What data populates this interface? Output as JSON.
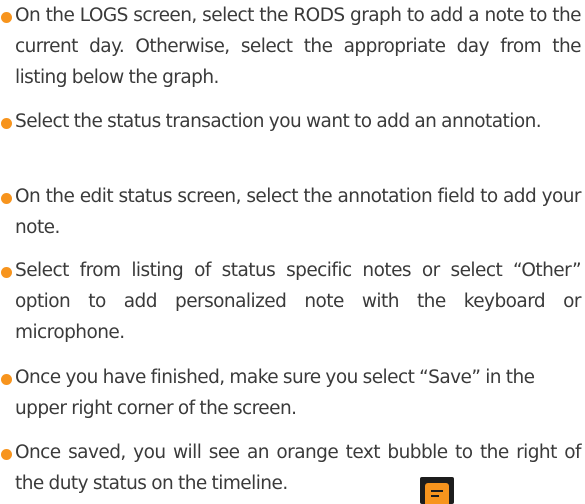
{
  "bullets": [
    {
      "text": "On the LOGS screen, select the RODS graph to add a note to the current day.  Otherwise, select the appropriate day from the listing below the graph."
    },
    {
      "text": "Select the status transaction you want to add an annotation."
    },
    {
      "text": "On the edit status screen, select the annotation field to add your note."
    },
    {
      "text": "Select from listing of status specific notes or select “Other” option to add personalized note with the keyboard or microphone."
    },
    {
      "text": "Once you have finished, make sure you select “Save” in the upper right corner of the screen."
    },
    {
      "text": "Once saved, you will see an orange text bubble to the right of the duty status on the timeline."
    }
  ],
  "colors": {
    "bullet": "#f7941d",
    "text": "#3a3a3a",
    "icon_accent": "#f7941d"
  },
  "icons": {
    "timeline_note": "orange-text-bubble-icon"
  }
}
